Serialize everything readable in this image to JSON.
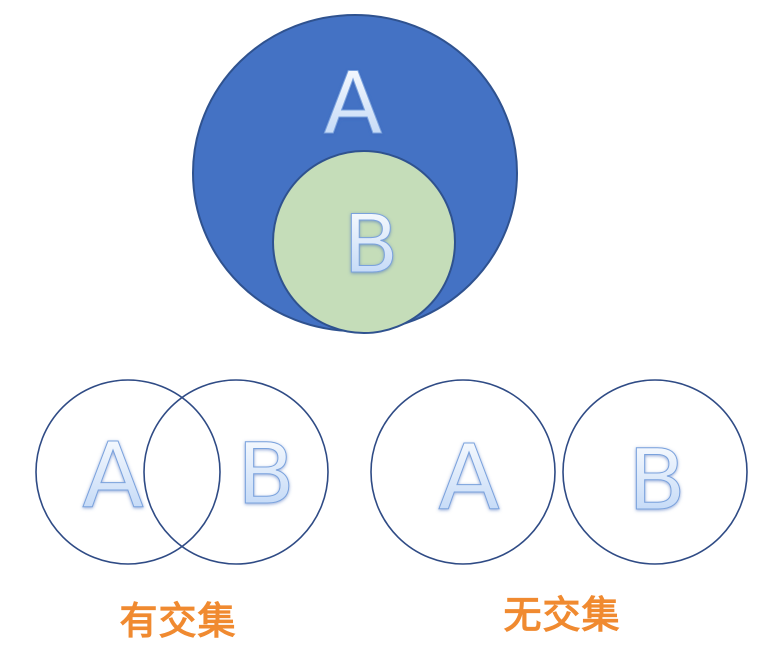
{
  "colors": {
    "outer_fill": "#4472c4",
    "outer_stroke": "#2f528f",
    "inner_fill": "#c5ddb9",
    "inner_stroke": "#2f528f",
    "outline_stroke": "#2f4b85",
    "letter_fill_top": "#ffffff",
    "letter_fill_bottom": "#b8d2f5",
    "letter_stroke": "#7aa2dd",
    "caption_color": "#f08a30"
  },
  "subset": {
    "outer_label": "A",
    "inner_label": "B"
  },
  "intersecting": {
    "left_label": "A",
    "right_label": "B",
    "caption": "有交集"
  },
  "disjoint": {
    "left_label": "A",
    "right_label": "B",
    "caption": "无交集"
  }
}
